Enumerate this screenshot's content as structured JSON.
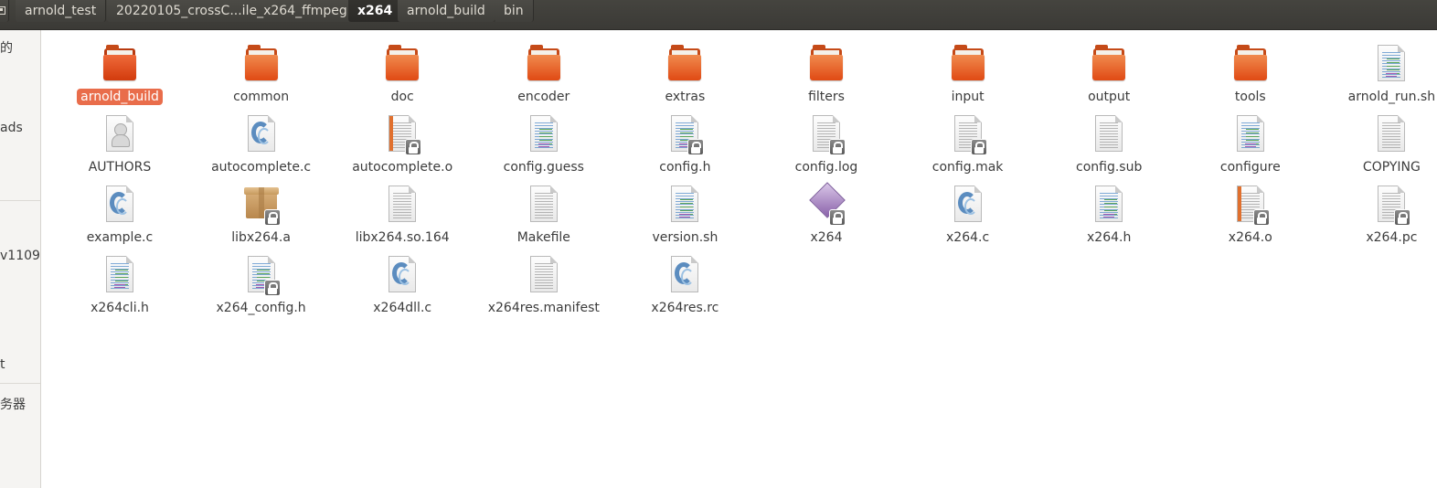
{
  "pathbar": {
    "crumbs": [
      {
        "label": "arnold_test"
      },
      {
        "label": "20220105_crossC...ile_x264_ffmpeg"
      },
      {
        "label": "x264"
      },
      {
        "label": "arnold_build"
      },
      {
        "label": "bin"
      }
    ],
    "active_crumb": "x264"
  },
  "sidebar": {
    "items": [
      {
        "label": "的"
      },
      {
        "label": "ads"
      },
      {
        "label": "v1109"
      },
      {
        "label": "t"
      },
      {
        "label": "务器"
      }
    ]
  },
  "files": [
    {
      "name": "arnold_build",
      "icon": "folder-icon",
      "selected": true
    },
    {
      "name": "common",
      "icon": "folder-icon"
    },
    {
      "name": "doc",
      "icon": "folder-icon"
    },
    {
      "name": "encoder",
      "icon": "folder-icon"
    },
    {
      "name": "extras",
      "icon": "folder-icon"
    },
    {
      "name": "filters",
      "icon": "folder-icon"
    },
    {
      "name": "input",
      "icon": "folder-icon"
    },
    {
      "name": "output",
      "icon": "folder-icon"
    },
    {
      "name": "tools",
      "icon": "folder-icon"
    },
    {
      "name": "arnold_run.sh",
      "icon": "shell-script-icon"
    },
    {
      "name": "AUTHORS",
      "icon": "authors-file-icon"
    },
    {
      "name": "autocomplete.c",
      "icon": "c-source-icon"
    },
    {
      "name": "autocomplete.o",
      "icon": "object-file-icon",
      "locked": true
    },
    {
      "name": "config.guess",
      "icon": "script-file-icon"
    },
    {
      "name": "config.h",
      "icon": "c-header-icon",
      "locked": true
    },
    {
      "name": "config.log",
      "icon": "text-file-icon",
      "locked": true
    },
    {
      "name": "config.mak",
      "icon": "text-file-icon",
      "locked": true
    },
    {
      "name": "config.sub",
      "icon": "text-file-icon"
    },
    {
      "name": "configure",
      "icon": "script-file-icon"
    },
    {
      "name": "COPYING",
      "icon": "text-file-icon"
    },
    {
      "name": "example.c",
      "icon": "c-source-icon"
    },
    {
      "name": "libx264.a",
      "icon": "archive-icon",
      "locked": true
    },
    {
      "name": "libx264.so.164",
      "icon": "text-file-icon"
    },
    {
      "name": "Makefile",
      "icon": "text-file-icon"
    },
    {
      "name": "version.sh",
      "icon": "shell-script-icon"
    },
    {
      "name": "x264",
      "icon": "executable-icon",
      "locked": true
    },
    {
      "name": "x264.c",
      "icon": "c-source-icon"
    },
    {
      "name": "x264.h",
      "icon": "c-header-icon"
    },
    {
      "name": "x264.o",
      "icon": "object-file-icon",
      "locked": true
    },
    {
      "name": "x264.pc",
      "icon": "text-file-icon",
      "locked": true
    },
    {
      "name": "x264cli.h",
      "icon": "c-header-icon"
    },
    {
      "name": "x264_config.h",
      "icon": "c-header-icon",
      "locked": true
    },
    {
      "name": "x264dll.c",
      "icon": "c-source-icon"
    },
    {
      "name": "x264res.manifest",
      "icon": "text-file-icon"
    },
    {
      "name": "x264res.rc",
      "icon": "c-source-icon"
    }
  ],
  "colors": {
    "folder": "#e04a14",
    "selection": "#e96d4b",
    "pathbar": "#3b3a36"
  }
}
